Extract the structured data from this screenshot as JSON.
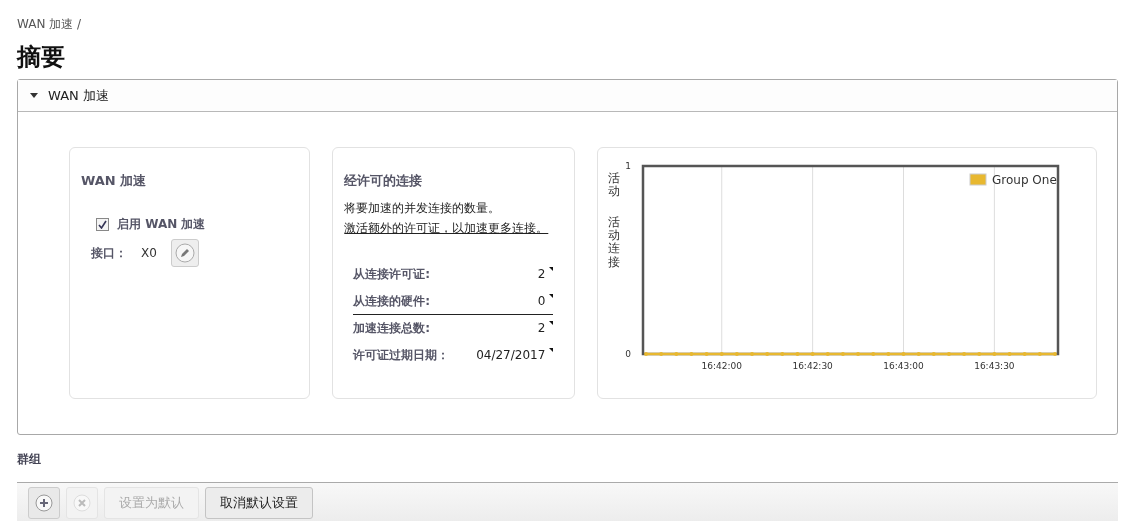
{
  "breadcrumb": "WAN 加速 /",
  "title": "摘要",
  "section": {
    "label": "WAN 加速",
    "expanded": true
  },
  "wan_card": {
    "title": "WAN 加速",
    "enable": {
      "label": "启用 WAN 加速",
      "checked": true
    },
    "interface_label": "接口：",
    "interface_value": "X0"
  },
  "license_card": {
    "title": "经许可的连接",
    "description": "将要加速的并发连接的数量。",
    "link": "激活额外的许可证，以加速更多连接。",
    "rows": [
      {
        "label": "从连接许可证:",
        "value": "2",
        "divider_after": false
      },
      {
        "label": "从连接的硬件:",
        "value": "0",
        "divider_after": true
      },
      {
        "label": "加速连接总数:",
        "value": "2",
        "divider_after": false
      },
      {
        "label": "许可证过期日期：",
        "value": "04/27/2017",
        "divider_after": false
      }
    ]
  },
  "chart_card": {
    "chart_data": {
      "type": "line",
      "title": "活动",
      "ylabel": "活动连接",
      "categories": [
        null,
        null,
        null,
        null,
        null,
        "16:42:00",
        null,
        null,
        null,
        null,
        null,
        "16:42:30",
        null,
        null,
        null,
        null,
        null,
        "16:43:00",
        null,
        null,
        null,
        null,
        null,
        "16:43:30",
        null,
        null,
        null,
        null
      ],
      "series": [
        {
          "name": "Group One",
          "color": "#e8b830",
          "values": [
            0,
            0,
            0,
            0,
            0,
            0,
            0,
            0,
            0,
            0,
            0,
            0,
            0,
            0,
            0,
            0,
            0,
            0,
            0,
            0,
            0,
            0,
            0,
            0,
            0,
            0,
            0,
            0
          ]
        }
      ],
      "ylim": [
        0,
        1
      ],
      "yticks": [
        0,
        1
      ],
      "grid": true
    }
  },
  "groups": {
    "title": "群组",
    "toolbar": [
      {
        "kind": "add",
        "disabled": false
      },
      {
        "kind": "delete",
        "disabled": true
      },
      {
        "kind": "text",
        "label": "设置为默认",
        "disabled": true
      },
      {
        "kind": "text",
        "label": "取消默认设置",
        "disabled": false
      }
    ]
  }
}
